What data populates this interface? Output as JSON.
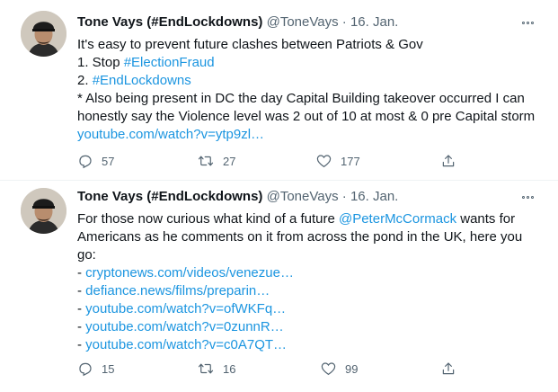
{
  "tweets": [
    {
      "author_name": "Tone Vays (#EndLockdowns)",
      "handle": "@ToneVays",
      "separator": "·",
      "date": "16. Jan.",
      "lines": [
        [
          {
            "t": "It's easy to prevent future clashes between Patriots & Gov"
          }
        ],
        [
          {
            "t": "1. Stop "
          },
          {
            "t": "#ElectionFraud",
            "link": true
          }
        ],
        [
          {
            "t": "2. "
          },
          {
            "t": "#EndLockdowns",
            "link": true
          }
        ],
        [
          {
            "t": "* Also being present in DC the day Capital Building takeover occurred I can"
          }
        ],
        [
          {
            "t": "honestly say the Violence level was 2 out of 10 at most & 0 pre Capital storm"
          }
        ],
        [
          {
            "t": "youtube.com/watch?v=ytp9zl…",
            "link": true
          }
        ]
      ],
      "replies": "57",
      "retweets": "27",
      "likes": "177"
    },
    {
      "author_name": "Tone Vays (#EndLockdowns)",
      "handle": "@ToneVays",
      "separator": "·",
      "date": "16. Jan.",
      "lines": [
        [
          {
            "t": "For those now curious what kind of a future "
          },
          {
            "t": "@PeterMcCormack",
            "link": true
          },
          {
            "t": " wants for"
          }
        ],
        [
          {
            "t": "Americans as he comments on it from across the pond in the UK, here you"
          }
        ],
        [
          {
            "t": "go:"
          }
        ],
        [
          {
            "t": "- "
          },
          {
            "t": "cryptonews.com/videos/venezue…",
            "link": true
          }
        ],
        [
          {
            "t": "- "
          },
          {
            "t": "defiance.news/films/preparin…",
            "link": true
          }
        ],
        [
          {
            "t": "- "
          },
          {
            "t": "youtube.com/watch?v=ofWKFq…",
            "link": true
          }
        ],
        [
          {
            "t": "- "
          },
          {
            "t": "youtube.com/watch?v=0zunnR…",
            "link": true
          }
        ],
        [
          {
            "t": "- "
          },
          {
            "t": "youtube.com/watch?v=c0A7QT…",
            "link": true
          }
        ]
      ],
      "replies": "15",
      "retweets": "16",
      "likes": "99"
    }
  ],
  "icons": {
    "reply": "reply-icon",
    "retweet": "retweet-icon",
    "like": "heart-icon",
    "share": "share-icon",
    "more": "more-options-icon"
  },
  "colors": {
    "link": "#1b95e0",
    "muted": "#536471",
    "text": "#0f1419",
    "divider": "#eff3f4"
  }
}
